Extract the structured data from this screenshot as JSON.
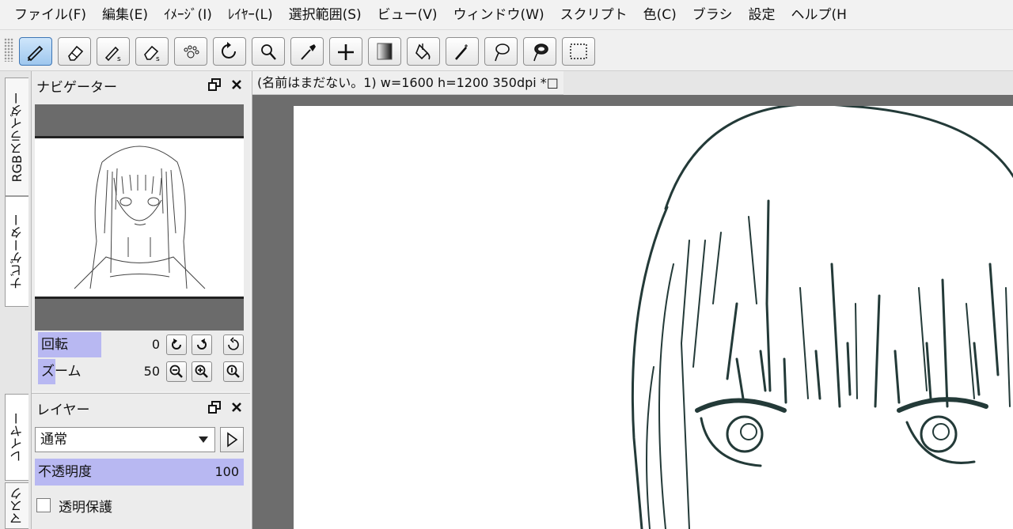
{
  "menubar": {
    "items": [
      "ファイル(F)",
      "編集(E)",
      "ｲﾒｰｼﾞ(I)",
      "ﾚｲﾔｰ(L)",
      "選択範囲(S)",
      "ビュー(V)",
      "ウィンドウ(W)",
      "スクリプト",
      "色(C)",
      "ブラシ",
      "設定",
      "ヘルプ(H"
    ]
  },
  "toolbar": {
    "tools": [
      {
        "icon": "pen-tool-icon",
        "active": true
      },
      {
        "icon": "eraser-tool-icon",
        "active": false
      },
      {
        "icon": "selection-pen-icon",
        "active": false
      },
      {
        "icon": "selection-eraser-icon",
        "active": false
      },
      {
        "icon": "paw-scatter-icon",
        "active": false
      },
      {
        "icon": "rotate-icon",
        "active": false
      },
      {
        "icon": "zoom-icon",
        "active": false
      },
      {
        "icon": "eyedropper-icon",
        "active": false
      },
      {
        "icon": "move-icon",
        "active": false
      },
      {
        "icon": "gradient-icon",
        "active": false
      },
      {
        "icon": "bucket-fill-icon",
        "active": false
      },
      {
        "icon": "magic-wand-icon",
        "active": false
      },
      {
        "icon": "lasso-icon",
        "active": false
      },
      {
        "icon": "lasso-fill-icon",
        "active": false
      },
      {
        "icon": "rectangle-select-icon",
        "active": false
      }
    ]
  },
  "side_tabs": {
    "rgb_slider": "RGBスライダー",
    "navigator": "ナビゲーター",
    "layer": "レイヤー",
    "mask": "マスク"
  },
  "navigator": {
    "title": "ナビゲーター",
    "rotation_label": "回転",
    "rotation_value": "0",
    "zoom_label": "ズーム",
    "zoom_value": "50"
  },
  "layer_panel": {
    "title": "レイヤー",
    "blend_mode": "通常",
    "opacity_label": "不透明度",
    "opacity_value": "100",
    "protect_alpha_label": "透明保護",
    "protect_alpha_checked": false
  },
  "document": {
    "tab_title": "(名前はまだない。1) w=1600 h=1200 350dpi *□"
  }
}
